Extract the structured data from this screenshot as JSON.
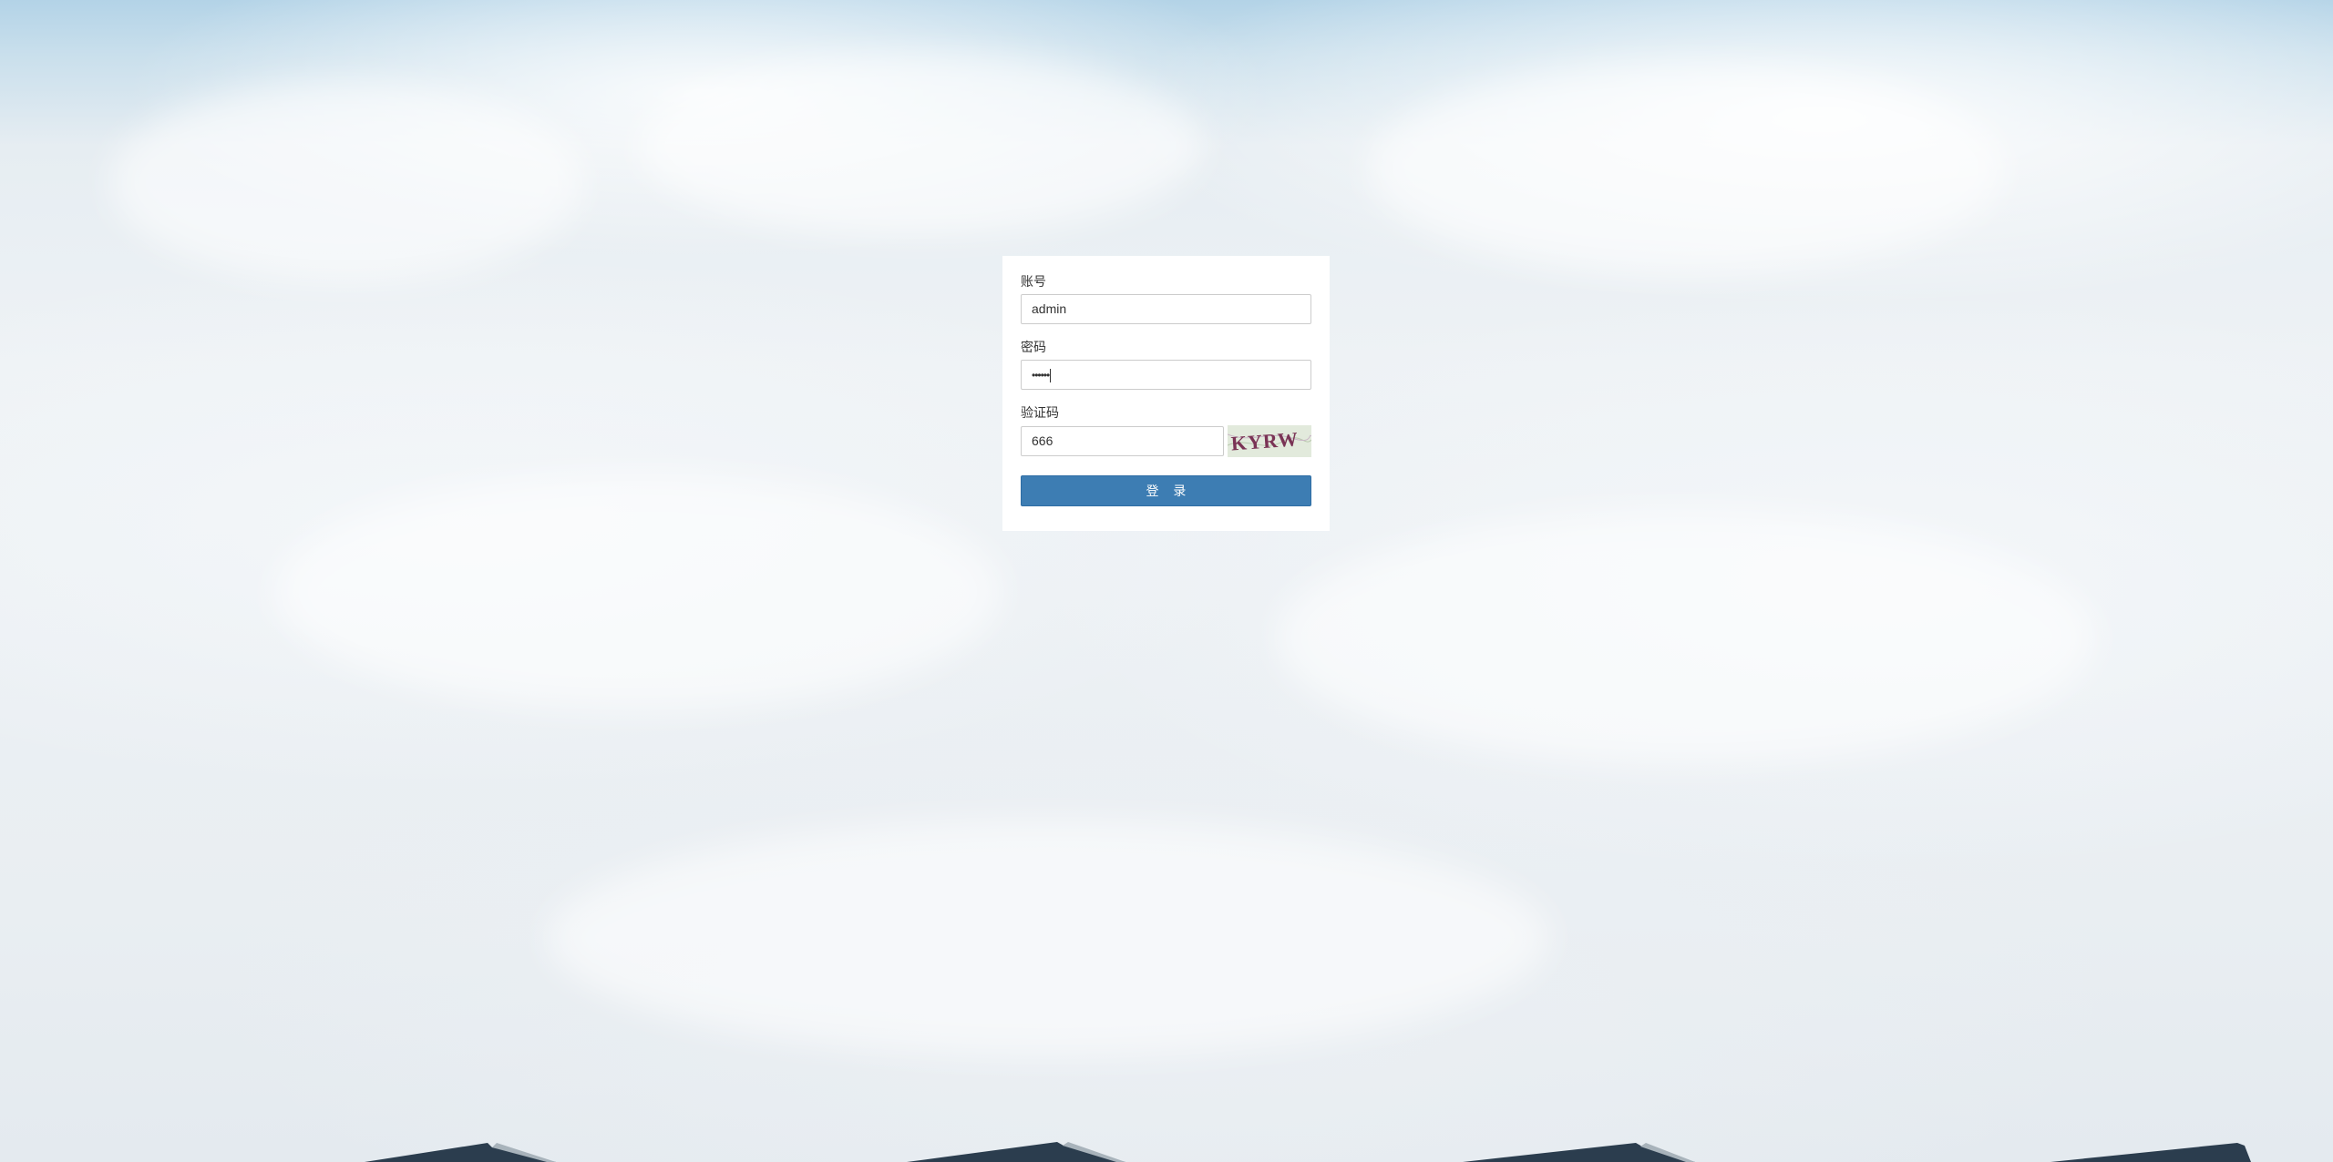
{
  "login": {
    "account_label": "账号",
    "account_value": "admin",
    "password_label": "密码",
    "password_value": "••••••",
    "captcha_label": "验证码",
    "captcha_value": "666",
    "captcha_image_text": "KYRW",
    "submit_label": "登 录"
  },
  "colors": {
    "button_bg": "#3d7db3",
    "sky_top": "#b3d3e7",
    "card_bg": "#ffffff"
  }
}
